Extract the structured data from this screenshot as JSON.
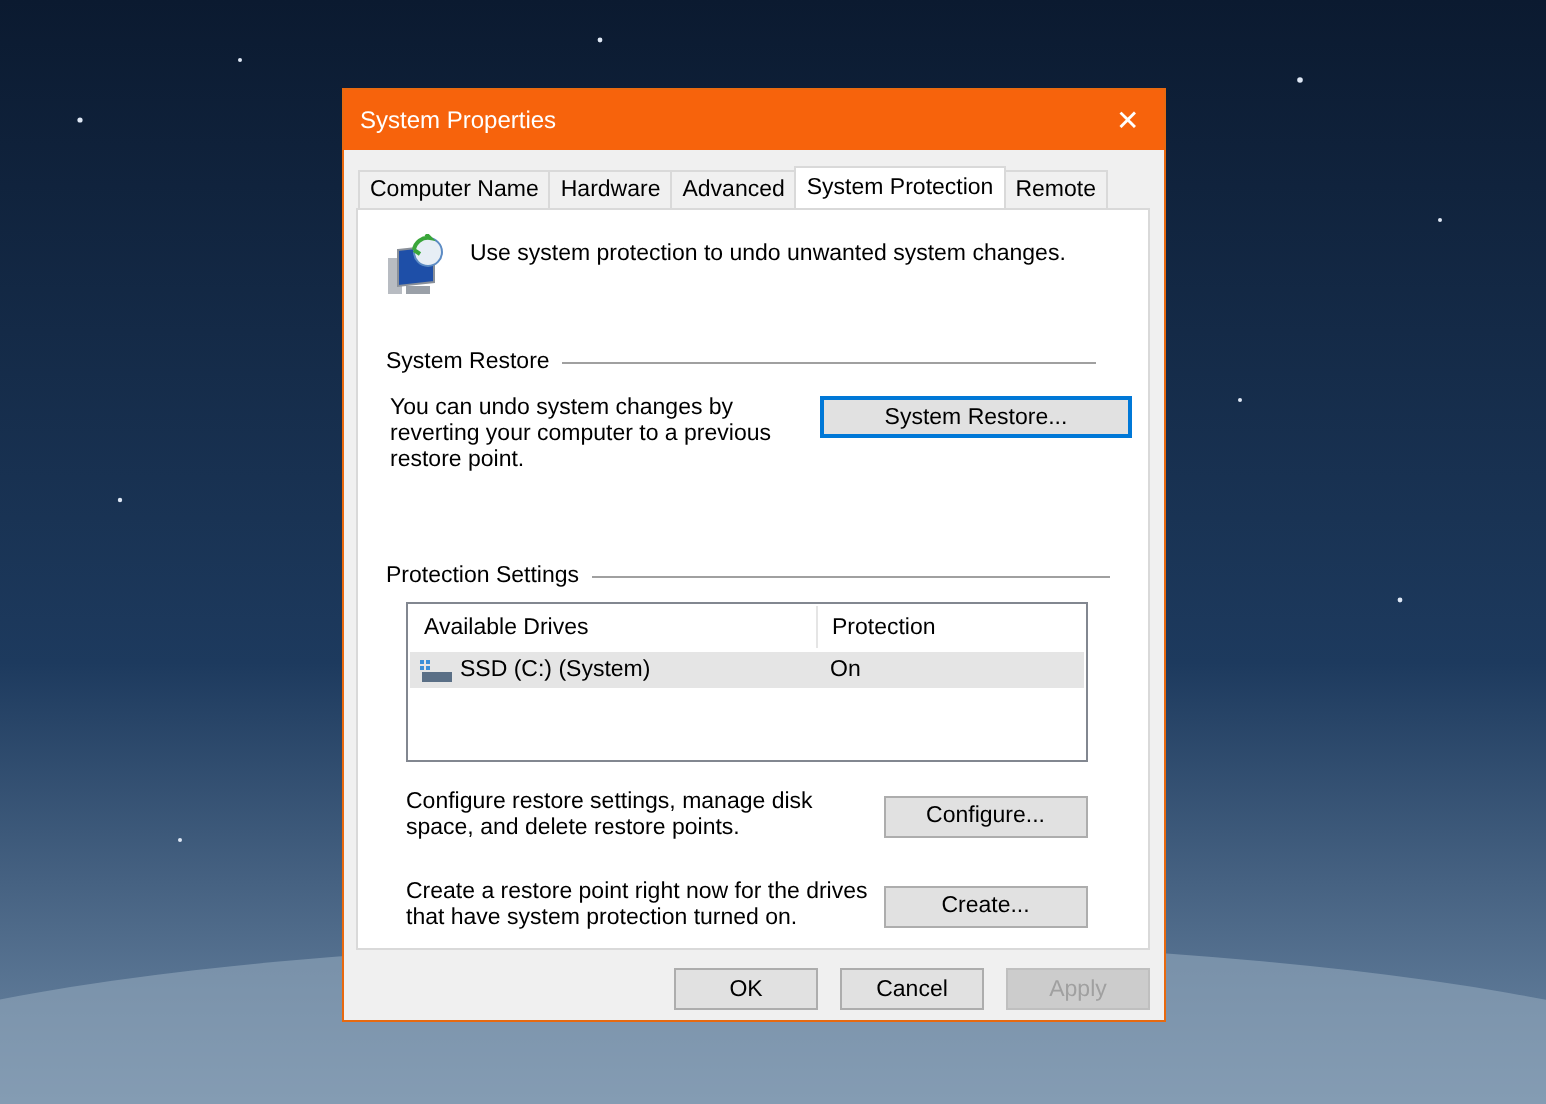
{
  "window": {
    "title": "System Properties",
    "close": "✕"
  },
  "tabs": [
    {
      "label": "Computer Name",
      "selected": false
    },
    {
      "label": "Hardware",
      "selected": false
    },
    {
      "label": "Advanced",
      "selected": false
    },
    {
      "label": "System Protection",
      "selected": true
    },
    {
      "label": "Remote",
      "selected": false
    }
  ],
  "intro": "Use system protection to undo unwanted system changes.",
  "system_restore": {
    "heading": "System Restore",
    "description": "You can undo system changes by reverting your computer to a previous restore point.",
    "button": {
      "label": "System Restore...",
      "focused": true
    }
  },
  "protection_settings": {
    "heading": "Protection Settings",
    "table": {
      "columns": [
        "Available Drives",
        "Protection"
      ],
      "rows": [
        {
          "drive": "SSD (C:) (System)",
          "protection": "On",
          "selected": true
        }
      ]
    },
    "actions": [
      {
        "description": "Configure restore settings, manage disk space, and delete restore points.",
        "button": "Configure..."
      },
      {
        "description": "Create a restore point right now for the drives that have system protection turned on.",
        "button": "Create..."
      }
    ]
  },
  "buttons": [
    {
      "label": "OK",
      "disabled": false
    },
    {
      "label": "Cancel",
      "disabled": false
    },
    {
      "label": "Apply",
      "disabled": true
    }
  ]
}
